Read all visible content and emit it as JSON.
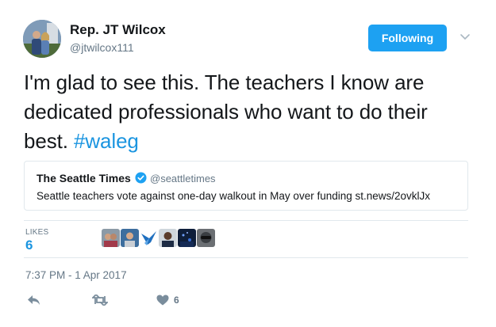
{
  "author": {
    "name": "Rep. JT Wilcox",
    "handle": "@jtwilcox111",
    "avatar_icon": "profile-photo-icon"
  },
  "follow_button": {
    "label": "Following",
    "color": "#1da1f2"
  },
  "tweet": {
    "text": "I'm glad to see this.  The teachers I know are dedicated professionals who want to do their best.",
    "hashtag": "#waleg"
  },
  "quoted_tweet": {
    "name": "The Seattle Times",
    "handle": "@seattletimes",
    "text": "Seattle teachers vote against one-day walkout in May over funding st.news/2ovklJx",
    "verified": true
  },
  "stats": {
    "likes_label": "LIKES",
    "likes_count": "6",
    "likers": [
      "liker-avatar-1",
      "liker-avatar-2",
      "liker-avatar-3",
      "liker-avatar-4",
      "liker-avatar-5",
      "liker-avatar-6"
    ]
  },
  "timestamp": "7:37 PM - 1 Apr 2017",
  "actions": {
    "reply_icon": "reply-icon",
    "retweet_icon": "retweet-icon",
    "like_icon": "heart-icon",
    "like_count": "6"
  },
  "colors": {
    "link": "#1b95e0",
    "muted": "#657786",
    "border": "#e1e8ed",
    "verified": "#1da1f2"
  }
}
